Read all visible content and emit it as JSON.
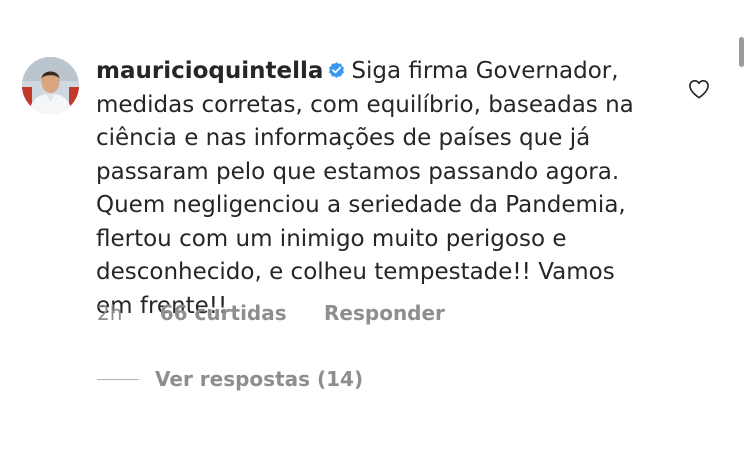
{
  "comment": {
    "username": "mauricioquintella",
    "verified_icon": "verified-badge-icon",
    "text_lines": [
      "Siga firma Governador,",
      "medidas corretas, com equilíbrio, baseadas na",
      "ciência e nas informações de países que já",
      "passaram pelo que estamos passando agora.",
      "Quem negligenciou a seriedade da Pandemia,",
      "flertou com um inimigo muito perigoso e",
      "desconhecido, e colheu tempestade!! Vamos",
      "em frente!!"
    ],
    "like_icon": "heart-outline-icon"
  },
  "meta": {
    "time": "2h",
    "likes": "66 curtidas",
    "reply": "Responder"
  },
  "replies": {
    "label": "Ver respostas (14)"
  },
  "colors": {
    "text": "#262626",
    "secondary": "#8e8e8e",
    "verified": "#3897f0"
  }
}
